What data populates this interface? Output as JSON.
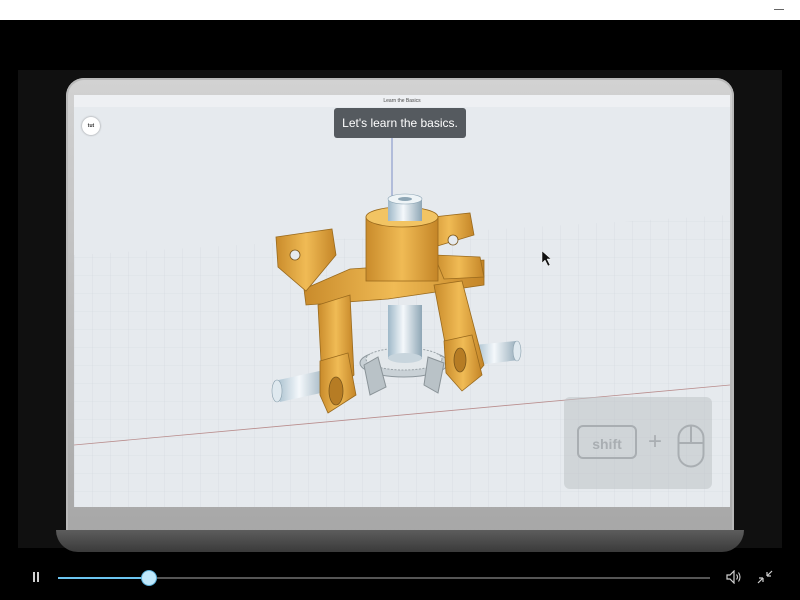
{
  "window": {
    "minimize_icon": "minimize-icon"
  },
  "video": {
    "screen_title": "Learn the Basics",
    "tooltip_text": "Let's learn the basics.",
    "logo_text": "tut",
    "shortcut": {
      "key_label": "shift",
      "plus": "+",
      "mouse_icon": "mouse-icon"
    }
  },
  "player": {
    "pause_icon": "pause-icon",
    "progress_fraction": 0.14,
    "volume_icon": "volume-icon",
    "exit_fullscreen_icon": "exit-fullscreen-icon",
    "accent_color": "#6cc5f0"
  }
}
